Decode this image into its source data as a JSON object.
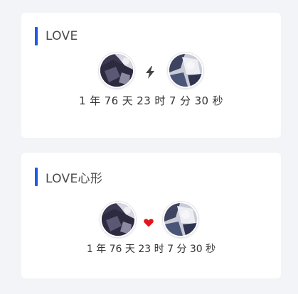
{
  "cards": [
    {
      "title": "LOVE",
      "icon": "lightning-icon",
      "timer": "1 年 76 天 23 时 7 分 30 秒"
    },
    {
      "title": "LOVE心形",
      "icon": "heart-icon",
      "timer": "1 年 76 天 23 时 7 分 30 秒"
    }
  ],
  "colors": {
    "accent": "#1e5be6",
    "heart": "#e0161b",
    "lightning": "#444444"
  }
}
